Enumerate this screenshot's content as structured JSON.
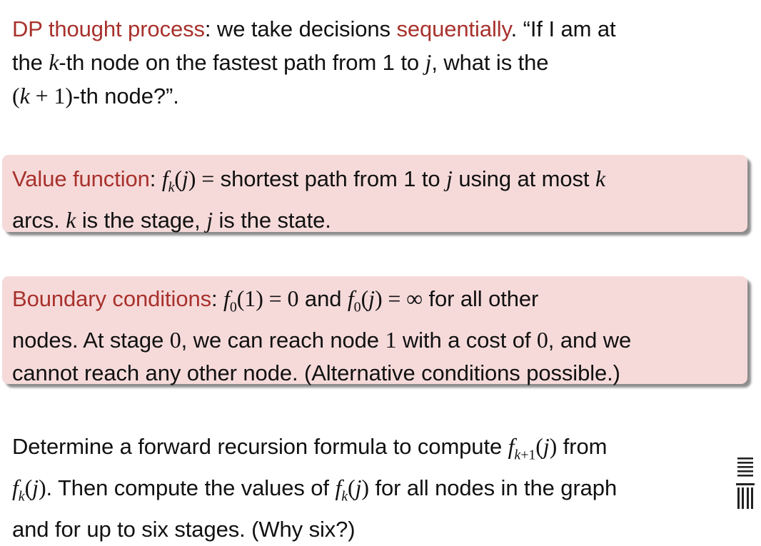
{
  "intro": {
    "dp_label": "DP thought process",
    "text_a": ": we take decisions ",
    "sequentially": "sequentially",
    "text_b": ". “If I am at",
    "text_c": "the ",
    "k": "k",
    "text_d": "-th node on the fastest path from 1 to ",
    "j": "j",
    "text_e": ", what is the",
    "kp1": "(k + 1)",
    "text_f": "-th node?”."
  },
  "value_function": {
    "label": "Value function",
    "colon": ": ",
    "f_k_j": "f_k(j) =",
    "text_a": " shortest path from 1 to ",
    "j": "j",
    "text_b": " using at most ",
    "k": "k",
    "text_c": "arcs. ",
    "k2": "k",
    "text_d": " is the stage, ",
    "j2": "j",
    "text_e": " is the state."
  },
  "boundary": {
    "label": "Boundary conditions",
    "colon": ": ",
    "f0_1": "f₀(1) = 0",
    "and": " and ",
    "f0_j": "f₀(j) = ∞",
    "text_a": " for all other",
    "text_b": "nodes. At stage ",
    "zero1": "0",
    "text_c": ", we can reach node ",
    "one": "1",
    "text_d": " with a cost of ",
    "zero2": "0",
    "text_e": ", and we",
    "text_f": "cannot reach any other node. (Alternative conditions possible.)"
  },
  "task": {
    "text_a": "Determine a forward recursion formula to compute ",
    "fk1j": "f_{k+1}(j)",
    "text_b": " from",
    "fkj": "f_k(j)",
    "text_c": ". Then compute the values of ",
    "fkj2": "f_k(j)",
    "text_d": " for all nodes in the graph",
    "text_e": "and for up to six stages. (Why six?)"
  },
  "colors": {
    "accent_red": "#a8312c",
    "box_fill": "#f6dada"
  },
  "icons": {
    "logo": "university-logo-icon"
  }
}
